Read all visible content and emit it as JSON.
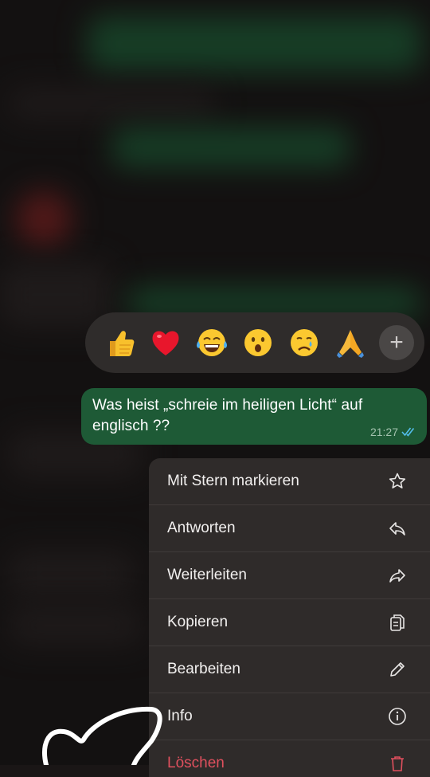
{
  "reactions": [
    {
      "icon": "thumbs-up-emoji"
    },
    {
      "icon": "red-heart-emoji"
    },
    {
      "icon": "tears-of-joy-emoji"
    },
    {
      "icon": "surprised-face-emoji"
    },
    {
      "icon": "crying-face-emoji"
    },
    {
      "icon": "folded-hands-emoji"
    }
  ],
  "more_reactions_icon": "plus-icon",
  "message": {
    "text": "Was heist  „schreie im heiligen Licht“ auf englisch ??",
    "time": "21:27",
    "status_icon": "double-check-icon",
    "bubble_color": "#1e5a36"
  },
  "menu": {
    "items": [
      {
        "label": "Mit Stern markieren",
        "icon": "star-icon"
      },
      {
        "label": "Antworten",
        "icon": "reply-icon"
      },
      {
        "label": "Weiterleiten",
        "icon": "forward-icon"
      },
      {
        "label": "Kopieren",
        "icon": "copy-icon"
      },
      {
        "label": "Bearbeiten",
        "icon": "pencil-icon"
      },
      {
        "label": "Info",
        "icon": "info-icon"
      },
      {
        "label": "Löschen",
        "icon": "trash-icon",
        "color": "#e0505e"
      }
    ]
  }
}
